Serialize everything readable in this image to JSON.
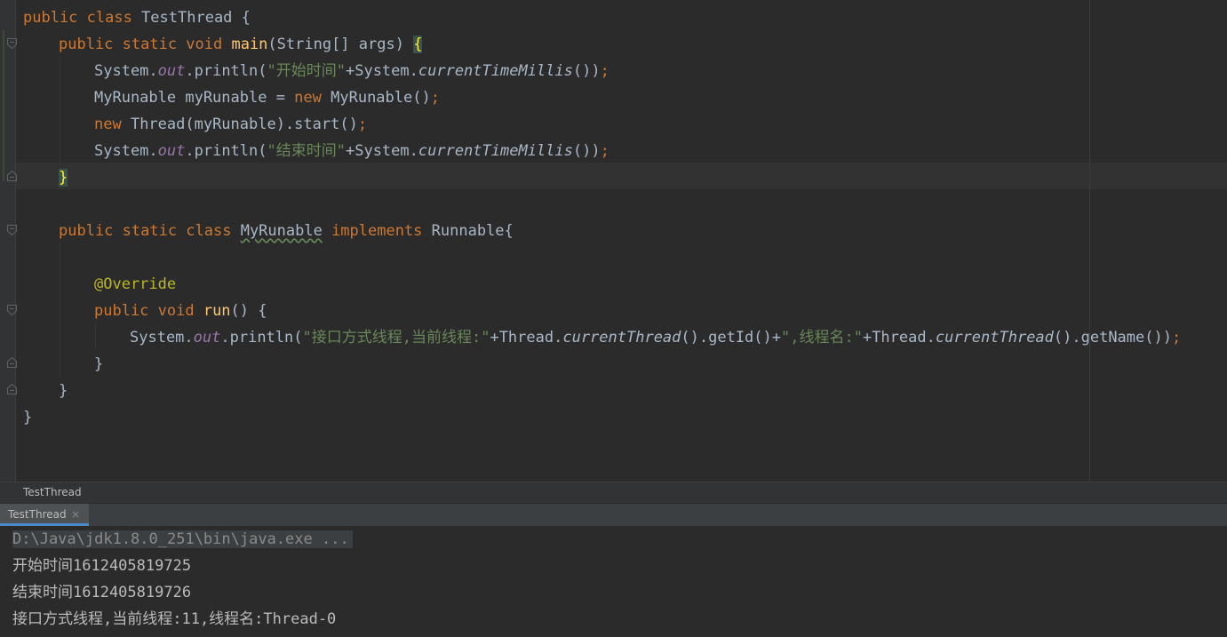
{
  "editor": {
    "lines": [
      {
        "indent": 0,
        "tokens": [
          [
            "kw",
            "public class "
          ],
          [
            "p",
            "TestThread {"
          ]
        ]
      },
      {
        "indent": 1,
        "tokens": [
          [
            "kw",
            "public static void "
          ],
          [
            "fn",
            "main"
          ],
          [
            "p",
            "(String[] args) "
          ],
          [
            "bh",
            "{"
          ]
        ]
      },
      {
        "indent": 2,
        "tokens": [
          [
            "p",
            "System."
          ],
          [
            "it",
            "out"
          ],
          [
            "p",
            ".println("
          ],
          [
            "st",
            "\"开始时间\""
          ],
          [
            "p",
            "+System."
          ],
          [
            "sm",
            "currentTimeMillis"
          ],
          [
            "p",
            "())"
          ],
          [
            "kw",
            ";"
          ]
        ]
      },
      {
        "indent": 2,
        "tokens": [
          [
            "p",
            "MyRunable myRunable = "
          ],
          [
            "kw",
            "new "
          ],
          [
            "p",
            "MyRunable()"
          ],
          [
            "kw",
            ";"
          ]
        ]
      },
      {
        "indent": 2,
        "tokens": [
          [
            "kw",
            "new "
          ],
          [
            "p",
            "Thread(myRunable).start()"
          ],
          [
            "kw",
            ";"
          ]
        ]
      },
      {
        "indent": 2,
        "tokens": [
          [
            "p",
            "System."
          ],
          [
            "it",
            "out"
          ],
          [
            "p",
            ".println("
          ],
          [
            "st",
            "\"结束时间\""
          ],
          [
            "p",
            "+System."
          ],
          [
            "sm",
            "currentTimeMillis"
          ],
          [
            "p",
            "())"
          ],
          [
            "kw",
            ";"
          ]
        ]
      },
      {
        "indent": 1,
        "tokens": [
          [
            "bh",
            "}"
          ]
        ]
      },
      {
        "indent": 0,
        "tokens": []
      },
      {
        "indent": 1,
        "tokens": [
          [
            "kw",
            "public static class "
          ],
          [
            "un",
            "MyRunable"
          ],
          [
            "kw",
            " implements "
          ],
          [
            "p",
            "Runnable{"
          ]
        ]
      },
      {
        "indent": 0,
        "tokens": []
      },
      {
        "indent": 2,
        "tokens": [
          [
            "an",
            "@Override"
          ]
        ]
      },
      {
        "indent": 2,
        "tokens": [
          [
            "kw",
            "public void "
          ],
          [
            "fn",
            "run"
          ],
          [
            "p",
            "() {"
          ]
        ]
      },
      {
        "indent": 3,
        "tokens": [
          [
            "p",
            "System."
          ],
          [
            "it",
            "out"
          ],
          [
            "p",
            ".println("
          ],
          [
            "st",
            "\"接口方式线程,当前线程:\""
          ],
          [
            "p",
            "+Thread."
          ],
          [
            "sm",
            "currentThread"
          ],
          [
            "p",
            "().getId()+"
          ],
          [
            "st",
            "\",线程名:\""
          ],
          [
            "p",
            "+Thread."
          ],
          [
            "sm",
            "currentThread"
          ],
          [
            "p",
            "().getName())"
          ],
          [
            "kw",
            ";"
          ]
        ]
      },
      {
        "indent": 2,
        "tokens": [
          [
            "p",
            "}"
          ]
        ]
      },
      {
        "indent": 1,
        "tokens": [
          [
            "p",
            "}"
          ]
        ]
      },
      {
        "indent": 0,
        "tokens": [
          [
            "p",
            "}"
          ]
        ]
      }
    ]
  },
  "breadcrumb": {
    "label": "TestThread"
  },
  "run_panel": {
    "tab_label": "TestThread",
    "close_glyph": "×",
    "console_lines": [
      "D:\\Java\\jdk1.8.0_251\\bin\\java.exe ...",
      "开始时间1612405819725",
      "结束时间1612405819726",
      "接口方式线程,当前线程:11,线程名:Thread-0"
    ]
  },
  "colors": {
    "keyword": "#cc7832",
    "method_decl": "#ffc66d",
    "string": "#6a8759",
    "static_field": "#9876aa",
    "annotation": "#bbb529",
    "plain": "#a9b7c6",
    "background": "#2b2b2b"
  }
}
